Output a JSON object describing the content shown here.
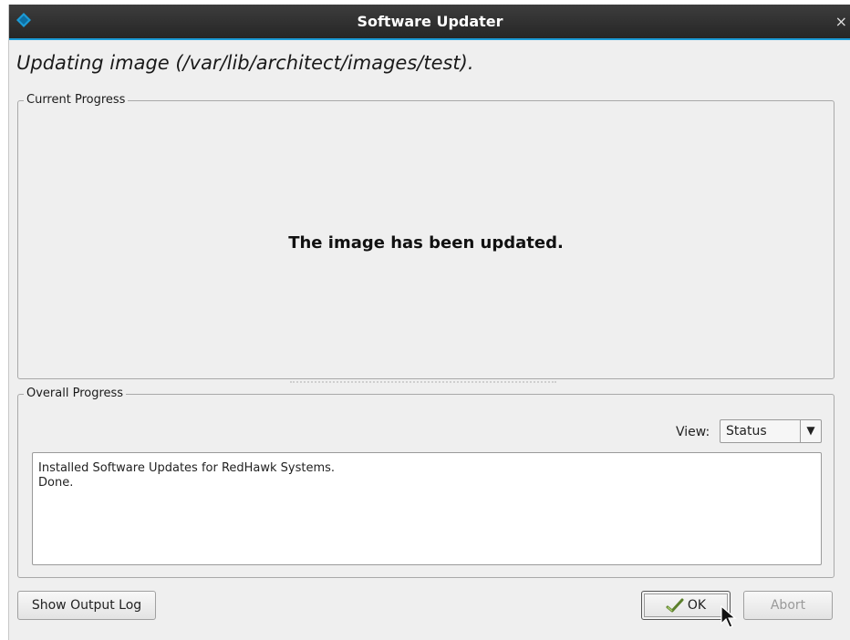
{
  "window": {
    "title": "Software Updater",
    "close_glyph": "×"
  },
  "heading": "Updating image (/var/lib/architect/images/test).",
  "current_progress": {
    "label": "Current Progress",
    "message": "The image has been updated."
  },
  "overall_progress": {
    "label": "Overall Progress",
    "view_label": "View:",
    "view_selected": "Status",
    "log_lines": [
      "Installed Software Updates for RedHawk Systems.",
      "Done."
    ]
  },
  "buttons": {
    "show_output_log": "Show Output Log",
    "ok": "OK",
    "abort": "Abort"
  },
  "colors": {
    "titlebar": "#2e2e2e",
    "title_accent": "#1c9bd6",
    "window_bg": "#efefef",
    "disabled_text": "#9a9a9a"
  },
  "icons": {
    "app": "app-diamond-icon",
    "close": "close-icon",
    "ok": "check-pen-icon",
    "dropdown": "chevron-down-icon",
    "cursor": "mouse-pointer-icon"
  }
}
